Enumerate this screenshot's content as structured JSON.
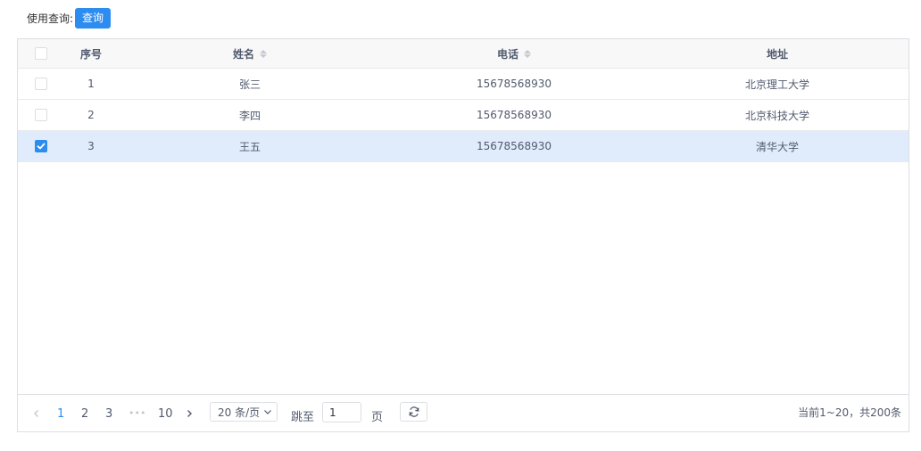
{
  "toolbar": {
    "label": "使用查询:",
    "query_button": "查询"
  },
  "table": {
    "columns": [
      "序号",
      "姓名",
      "电话",
      "地址"
    ],
    "rows": [
      {
        "seq": "1",
        "name": "张三",
        "phone": "15678568930",
        "address": "北京理工大学",
        "checked": false
      },
      {
        "seq": "2",
        "name": "李四",
        "phone": "15678568930",
        "address": "北京科技大学",
        "checked": false
      },
      {
        "seq": "3",
        "name": "王五",
        "phone": "15678568930",
        "address": "清华大学",
        "checked": true
      }
    ]
  },
  "pagination": {
    "pages": [
      "1",
      "2",
      "3",
      "•••",
      "10"
    ],
    "current_page": "1",
    "page_size": "20 条/页",
    "goto_label": "跳至",
    "goto_value": "1",
    "page_unit": "页",
    "summary": "当前1~20，共200条"
  },
  "colors": {
    "primary": "#2d8cf0",
    "selected_row": "#e0ecfb",
    "header_bg": "#f8f8f9"
  }
}
